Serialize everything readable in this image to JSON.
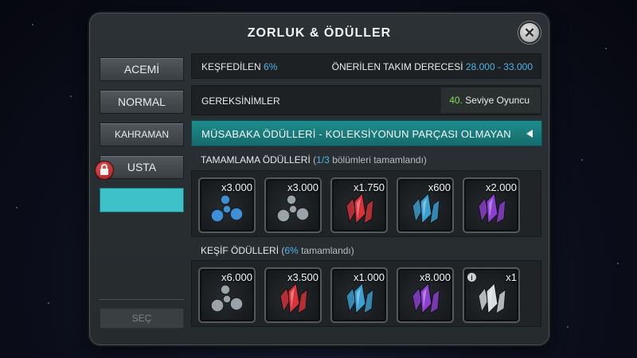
{
  "dialog": {
    "title": "ZORLUK & ÖDÜLLER"
  },
  "difficulties": [
    {
      "label": "ACEMİ"
    },
    {
      "label": "NORMAL"
    },
    {
      "label": "KAHRAMAN"
    },
    {
      "label": "USTA",
      "locked": true
    }
  ],
  "teal_button_label": "",
  "select_button": "SEÇ",
  "exploration": {
    "label": "KEŞFEDİLEN",
    "value": "6%",
    "team_rating_label": "ÖNERİLEN TAKIM DERECESİ",
    "team_rating_value": "28.000 - 33.000"
  },
  "requirements": {
    "label": "GEREKSİNİMLER",
    "level": "40.",
    "level_text": "Seviye Oyuncu"
  },
  "banner": {
    "text": "MÜSABAKA ÖDÜLLERİ - KOLEKSİYONUN PARÇASI OLMAYAN"
  },
  "completion": {
    "label": "TAMAMLAMA ÖDÜLLERİ",
    "paren_open": "(",
    "progress": "1/3",
    "progress_text": "bölümleri tamamlandı)",
    "rewards": [
      {
        "qty": "x3.000",
        "icon": "blue-catalyst-icon",
        "color": "#3d8fd6"
      },
      {
        "qty": "x3.000",
        "icon": "grey-catalyst-icon",
        "color": "#9aa3a8"
      },
      {
        "qty": "x1.750",
        "icon": "red-crystal-icon",
        "color": "#d8323a"
      },
      {
        "qty": "x600",
        "icon": "blue-crystal-icon",
        "color": "#3aa0d0"
      },
      {
        "qty": "x2.000",
        "icon": "purple-crystal-icon",
        "color": "#8c3fd0"
      }
    ]
  },
  "exploration_rewards": {
    "label": "KEŞİF ÖDÜLLERİ",
    "paren_open": "(",
    "progress": "6%",
    "progress_text": "tamamlandı)",
    "rewards": [
      {
        "qty": "x6.000",
        "icon": "grey-catalyst-icon",
        "color": "#9aa3a8"
      },
      {
        "qty": "x3.500",
        "icon": "red-crystal-icon",
        "color": "#d8323a"
      },
      {
        "qty": "x1.000",
        "icon": "blue-crystal-icon",
        "color": "#3aa0d0"
      },
      {
        "qty": "x8.000",
        "icon": "purple-crystal-icon",
        "color": "#8c3fd0"
      },
      {
        "qty": "x1",
        "icon": "silver-crystal-icon",
        "color": "#d8dde0",
        "info": "i"
      }
    ]
  },
  "colors": {
    "accent_blue": "#4db2e6",
    "accent_green": "#7ee05a",
    "banner_teal": "#1f8c8d",
    "teal_button": "#3fc1ca"
  }
}
